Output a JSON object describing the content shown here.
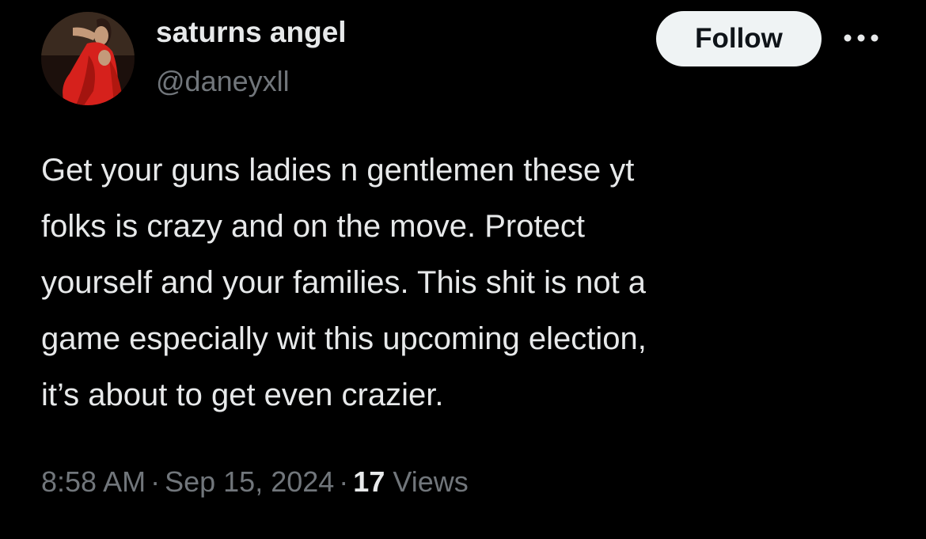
{
  "colors": {
    "background": "#000000",
    "primary_text": "#e7e9ea",
    "secondary_text": "#71767b",
    "follow_button_bg": "#eff3f4",
    "follow_button_text": "#0f1419",
    "avatar_accent": "#d6211c"
  },
  "author": {
    "display_name": "saturns angel",
    "handle": "@daneyxll",
    "avatar_icon": "avatar-photo"
  },
  "actions": {
    "follow_label": "Follow",
    "more_icon": "more-horizontal-icon"
  },
  "tweet": {
    "lines": [
      "Get your guns ladies n gentlemen these yt",
      "folks is crazy and on the move. Protect",
      "yourself and your families. This shit is not a",
      "game especially wit this upcoming election,",
      "it’s about to get even crazier."
    ]
  },
  "meta": {
    "time": "8:58 AM",
    "separator": "·",
    "date": "Sep 15, 2024",
    "views_count": "17",
    "views_label": "Views"
  }
}
